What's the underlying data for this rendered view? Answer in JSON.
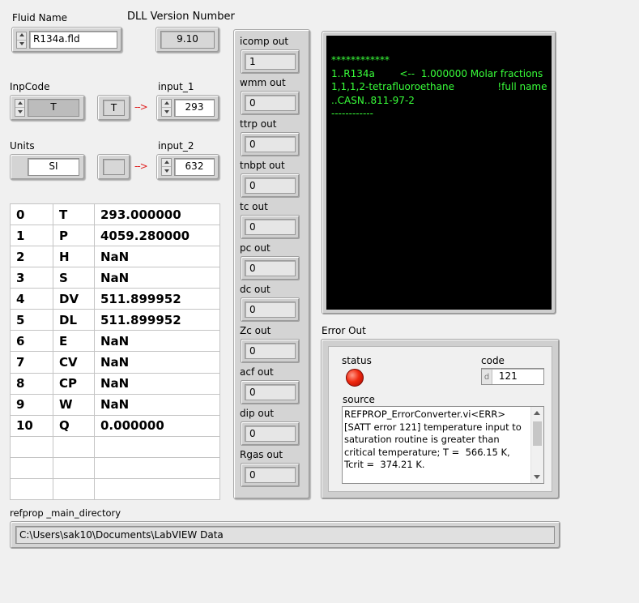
{
  "fluid": {
    "label": "Fluid Name",
    "value": "R134a.fld"
  },
  "dll": {
    "label": "DLL Version Number",
    "value": "9.10"
  },
  "inpcode": {
    "label": "InpCode",
    "value": "T",
    "indicator": "T",
    "arrow": "-->"
  },
  "input_1": {
    "label": "input_1",
    "value": "293"
  },
  "units": {
    "label": "Units",
    "value": "SI",
    "indicator": "",
    "arrow": "-->"
  },
  "input_2": {
    "label": "input_2",
    "value": "632"
  },
  "results": [
    [
      "0",
      "T",
      "293.000000"
    ],
    [
      "1",
      "P",
      "4059.280000"
    ],
    [
      "2",
      "H",
      "NaN"
    ],
    [
      "3",
      "S",
      "NaN"
    ],
    [
      "4",
      "DV",
      "511.899952"
    ],
    [
      "5",
      "DL",
      "511.899952"
    ],
    [
      "6",
      "E",
      "NaN"
    ],
    [
      "7",
      "CV",
      "NaN"
    ],
    [
      "8",
      "CP",
      "NaN"
    ],
    [
      "9",
      "W",
      "NaN"
    ],
    [
      "10",
      "Q",
      "0.000000"
    ],
    [
      "",
      "",
      ""
    ],
    [
      "",
      "",
      ""
    ],
    [
      "",
      "",
      ""
    ]
  ],
  "outputs": [
    {
      "label": "icomp out",
      "value": "1"
    },
    {
      "label": "wmm out",
      "value": "0"
    },
    {
      "label": "ttrp out",
      "value": "0"
    },
    {
      "label": "tnbpt out",
      "value": "0"
    },
    {
      "label": "tc out",
      "value": "0"
    },
    {
      "label": "pc out",
      "value": "0"
    },
    {
      "label": "dc out",
      "value": "0"
    },
    {
      "label": "Zc out",
      "value": "0"
    },
    {
      "label": "acf out",
      "value": "0"
    },
    {
      "label": "dip out",
      "value": "0"
    },
    {
      "label": "Rgas out",
      "value": "0"
    }
  ],
  "console": {
    "lines": [
      "************",
      "1..R134a        <--  1.000000 Molar fractions",
      "1,1,1,2-tetrafluoroethane              !full name",
      "..CASN..811-97-2",
      "------------"
    ]
  },
  "error": {
    "label": "Error Out",
    "status_label": "status",
    "code_label": "code",
    "code_prefix": "d",
    "code": "121",
    "source_label": "source",
    "source": "REFPROP_ErrorConverter.vi<ERR>\n[SATT error 121] temperature input to saturation routine is greater than critical temperature; T =  566.15 K, Tcrit =  374.21 K."
  },
  "refprop_dir": {
    "label": "refprop _main_directory",
    "value": "C:\\Users\\sak10\\Documents\\LabVIEW Data"
  },
  "colors": {
    "console_text": "#39ff3a",
    "led_on": "#f02a10",
    "arrow": "#e02020"
  }
}
